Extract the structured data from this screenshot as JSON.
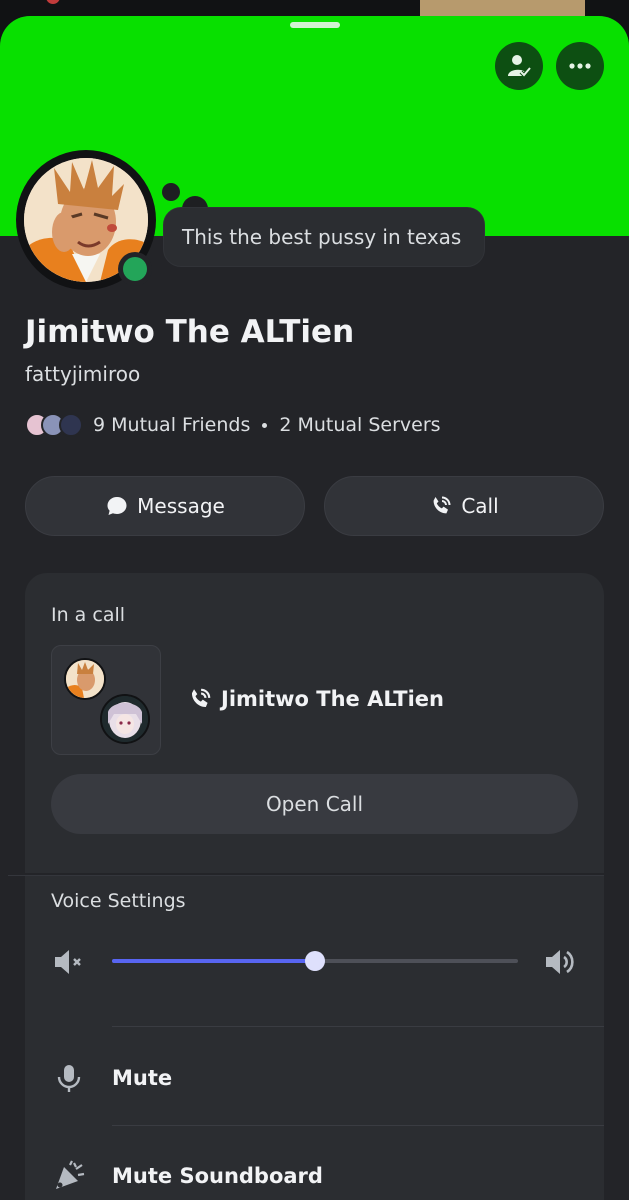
{
  "colors": {
    "banner": "#08e000",
    "surface": "#232428",
    "card": "#2b2d31",
    "online": "#23a559",
    "accent": "#5865f2"
  },
  "header": {
    "actions": [
      {
        "icon": "person-check-icon"
      },
      {
        "icon": "more-horizontal-icon"
      }
    ]
  },
  "profile": {
    "custom_status": "This the best pussy in texas",
    "display_name": "Jimitwo The ALTien",
    "username": "fattyjimiroo",
    "status": "online",
    "mutual_friends": "9 Mutual Friends",
    "mutual_servers": "2 Mutual Servers"
  },
  "actions": {
    "message_label": "Message",
    "call_label": "Call"
  },
  "call_card": {
    "heading": "In a call",
    "participant_name": "Jimitwo The ALTien",
    "open_call_label": "Open Call"
  },
  "voice_settings": {
    "heading": "Voice Settings",
    "volume": 0.5,
    "items": [
      {
        "label": "Mute",
        "icon": "microphone-icon"
      },
      {
        "label": "Mute Soundboard",
        "icon": "soundboard-icon"
      }
    ]
  }
}
